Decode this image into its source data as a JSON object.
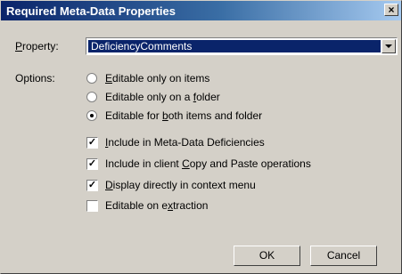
{
  "window": {
    "title": "Required Meta-Data Properties",
    "close_glyph": "×"
  },
  "property": {
    "label_prefix": "",
    "label_underlined": "P",
    "label_rest": "roperty:",
    "selected_value": "DeficiencyComments"
  },
  "options": {
    "label": "Options:",
    "radios": [
      {
        "pre": "",
        "u": "E",
        "post": "ditable only on items",
        "selected": false
      },
      {
        "pre": "Editable only on a ",
        "u": "f",
        "post": "older",
        "selected": false
      },
      {
        "pre": "Editable for ",
        "u": "b",
        "post": "oth items and folder",
        "selected": true
      }
    ],
    "checks": [
      {
        "pre": "",
        "u": "I",
        "post": "nclude in Meta-Data Deficiencies",
        "checked": true
      },
      {
        "pre": "Include in client ",
        "u": "C",
        "post": "opy and Paste operations",
        "checked": true
      },
      {
        "pre": "",
        "u": "D",
        "post": "isplay directly in context menu",
        "checked": true
      },
      {
        "pre": "Editable on e",
        "u": "x",
        "post": "traction",
        "checked": false
      }
    ]
  },
  "buttons": {
    "ok": "OK",
    "cancel": "Cancel"
  }
}
